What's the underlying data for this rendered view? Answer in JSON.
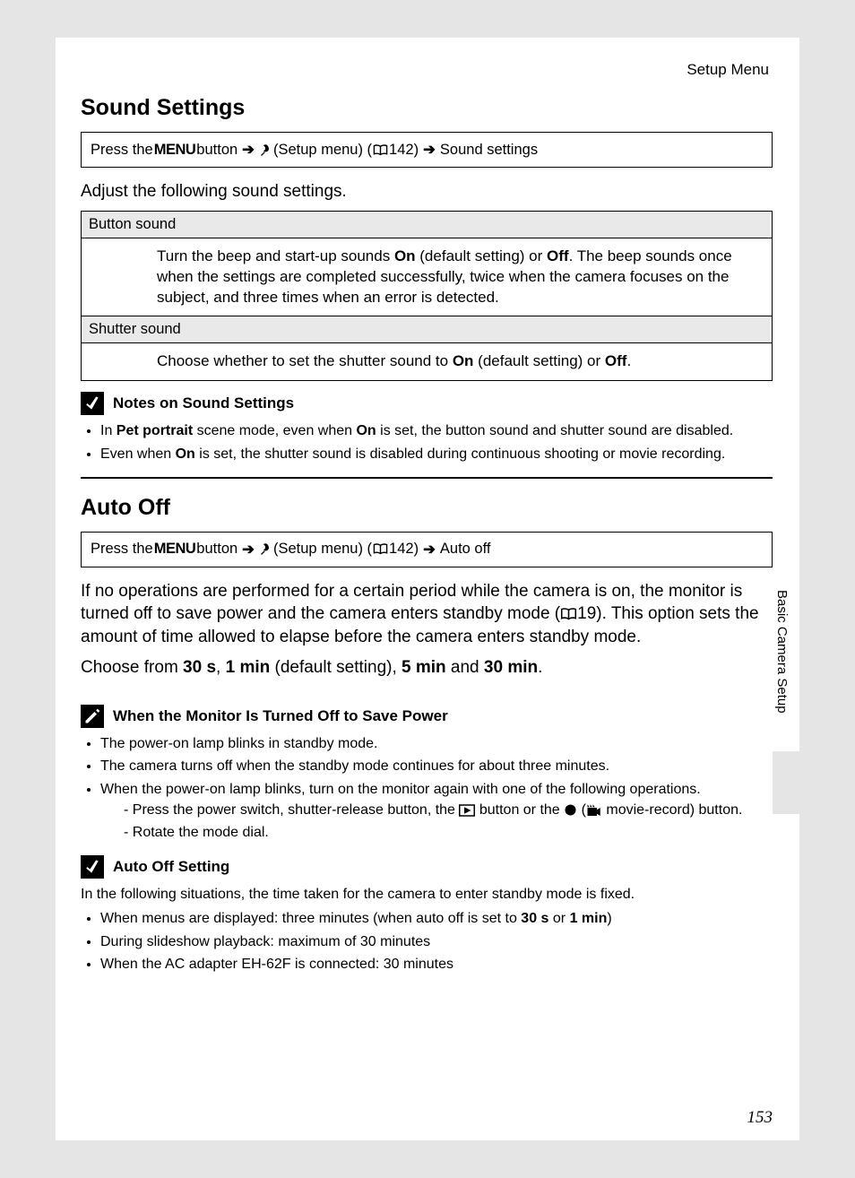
{
  "header": {
    "section": "Setup Menu"
  },
  "sound": {
    "title": "Sound Settings",
    "nav_prefix": "Press the ",
    "nav_menu": "MENU",
    "nav_button": " button ",
    "nav_setup": " (Setup menu) (",
    "nav_page1": "142) ",
    "nav_end": " Sound settings",
    "intro": "Adjust the following sound settings.",
    "row1_header": "Button sound",
    "row1_a": "Turn the beep and start-up sounds ",
    "row1_on": "On",
    "row1_b": " (default setting) or ",
    "row1_off": "Off",
    "row1_c": ". The beep sounds once when the settings are completed successfully, twice when the camera focuses on the subject, and three times when an error is detected.",
    "row2_header": "Shutter sound",
    "row2_a": "Choose whether to set the shutter sound to ",
    "row2_on": "On",
    "row2_b": " (default setting) or ",
    "row2_off": "Off",
    "row2_c": ".",
    "notes_title": "Notes on Sound Settings",
    "note1_a": "In ",
    "note1_b": "Pet portrait",
    "note1_c": " scene mode, even when ",
    "note1_on": "On",
    "note1_d": " is set, the button sound and shutter sound are disabled.",
    "note2_a": "Even when ",
    "note2_on": "On",
    "note2_b": " is set, the shutter sound is disabled during continuous shooting or movie recording."
  },
  "autooff": {
    "title": "Auto Off",
    "nav_prefix": "Press the ",
    "nav_menu": "MENU",
    "nav_button": " button ",
    "nav_setup": " (Setup menu) (",
    "nav_page1": "142) ",
    "nav_end": " Auto off",
    "body_a": "If no operations are performed for a certain period while the camera is on, the monitor is turned off to save power and the camera enters standby mode (",
    "body_page": "19). This option sets the amount of time allowed to elapse before the camera enters standby mode.",
    "choose_a": "Choose from ",
    "opt1": "30 s",
    "sep1": ", ",
    "opt2": "1 min",
    "choose_b": " (default setting), ",
    "opt3": "5 min",
    "sep2": " and ",
    "opt4": "30 min",
    "choose_c": ".",
    "tip_title": "When the Monitor Is Turned Off to Save Power",
    "tip1": "The power-on lamp blinks in standby mode.",
    "tip2": "The camera turns off when the standby mode continues for about three minutes.",
    "tip3": "When the power-on lamp blinks, turn on the monitor again with one of the following operations.",
    "tip3a_pre": "-   Press the power switch, shutter-release button, the ",
    "tip3a_mid": " button or the ",
    "tip3a_paren_open": " (",
    "tip3a_post": " movie-record) button.",
    "tip3b": "-   Rotate the mode dial.",
    "setting_title": "Auto Off Setting",
    "setting_intro": "In the following situations, the time taken for the camera to enter standby mode is fixed.",
    "s1_a": "When menus are displayed: three minutes (when auto off is set to ",
    "s1_b": "30 s",
    "s1_c": " or ",
    "s1_d": "1 min",
    "s1_e": ")",
    "s2": "During slideshow playback: maximum of 30 minutes",
    "s3": "When the AC adapter EH-62F is connected: 30 minutes"
  },
  "side_tab": "Basic Camera Setup",
  "page_number": "153"
}
